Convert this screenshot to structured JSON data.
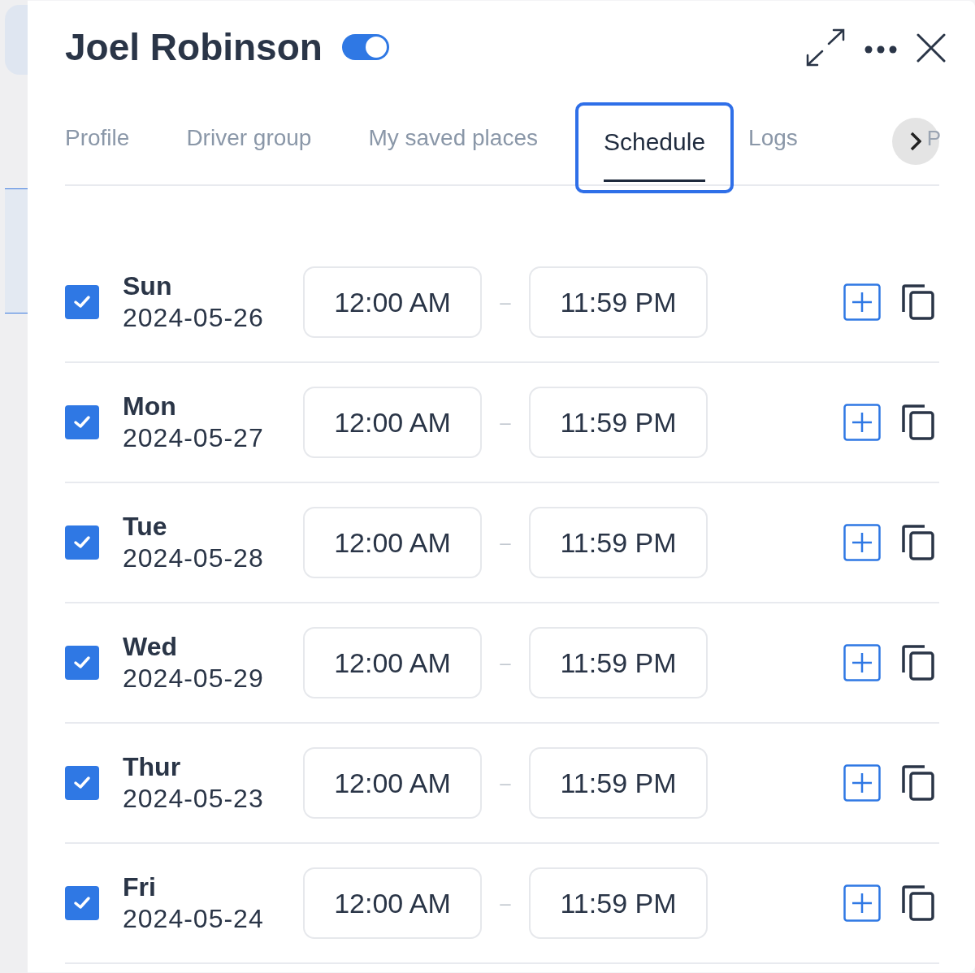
{
  "header": {
    "title": "Joel Robinson",
    "active_toggle": {
      "on": true
    }
  },
  "tabs": [
    {
      "label": "Profile",
      "selected": false
    },
    {
      "label": "Driver group",
      "selected": false
    },
    {
      "label": "My saved places",
      "selected": false
    },
    {
      "label": "Schedule",
      "selected": true
    },
    {
      "label": "Logs",
      "selected": false
    },
    {
      "label": "P",
      "selected": false
    }
  ],
  "schedule": [
    {
      "day": "Sun",
      "date": "2024-05-26",
      "checked": true,
      "start": "12:00 AM",
      "separator": "–",
      "end": "11:59 PM"
    },
    {
      "day": "Mon",
      "date": "2024-05-27",
      "checked": true,
      "start": "12:00 AM",
      "separator": "–",
      "end": "11:59 PM"
    },
    {
      "day": "Tue",
      "date": "2024-05-28",
      "checked": true,
      "start": "12:00 AM",
      "separator": "–",
      "end": "11:59 PM"
    },
    {
      "day": "Wed",
      "date": "2024-05-29",
      "checked": true,
      "start": "12:00 AM",
      "separator": "–",
      "end": "11:59 PM"
    },
    {
      "day": "Thur",
      "date": "2024-05-23",
      "checked": true,
      "start": "12:00 AM",
      "separator": "–",
      "end": "11:59 PM"
    },
    {
      "day": "Fri",
      "date": "2024-05-24",
      "checked": true,
      "start": "12:00 AM",
      "separator": "–",
      "end": "11:59 PM"
    }
  ]
}
